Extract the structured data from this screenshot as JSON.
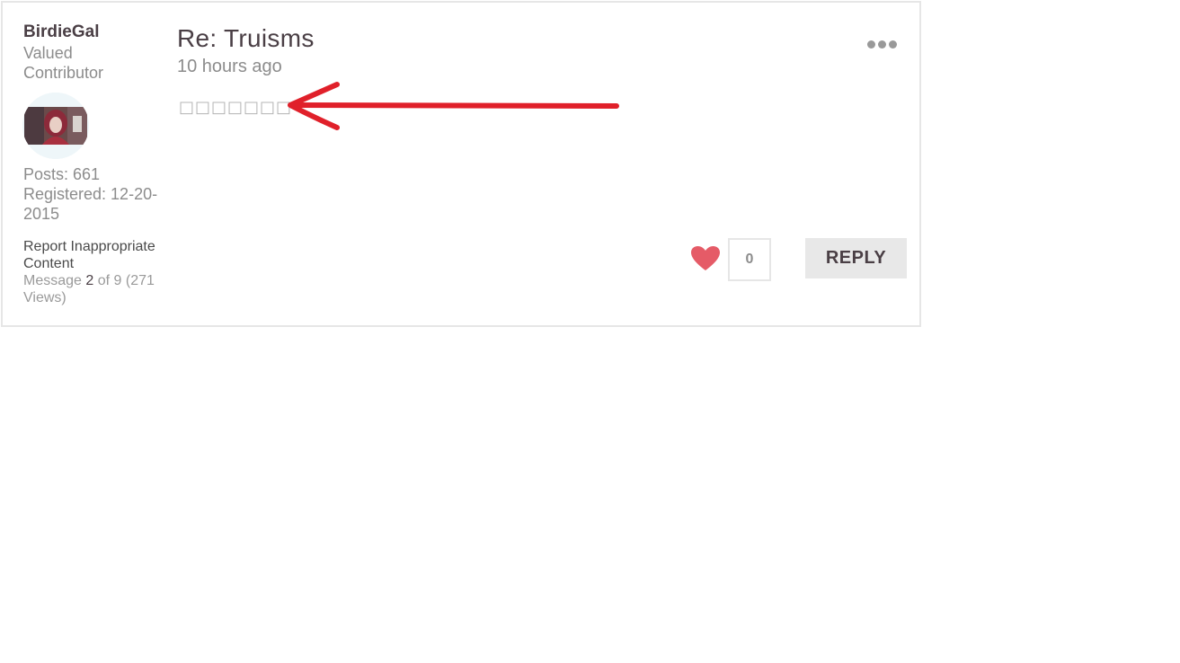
{
  "author": {
    "name": "BirdieGal",
    "rank": "Valued Contributor",
    "posts": "Posts: 661",
    "registered": "Registered: 12-20-2015"
  },
  "report_link": "Report Inappropriate Content",
  "message_info": {
    "prefix": "Message",
    "number": "2",
    "suffix": "of 9 (271 Views)"
  },
  "post": {
    "title": "Re: Truisms",
    "time": "10 hours ago",
    "body": "□□□□□□□"
  },
  "kudos": {
    "count": "0"
  },
  "reply_label": "REPLY",
  "colors": {
    "arrow": "#e0202a",
    "heart": "#e55b67",
    "border": "#e6e6e6",
    "reply_bg": "#e8e8e8"
  },
  "icons": [
    "more-options-icon",
    "heart-icon"
  ]
}
